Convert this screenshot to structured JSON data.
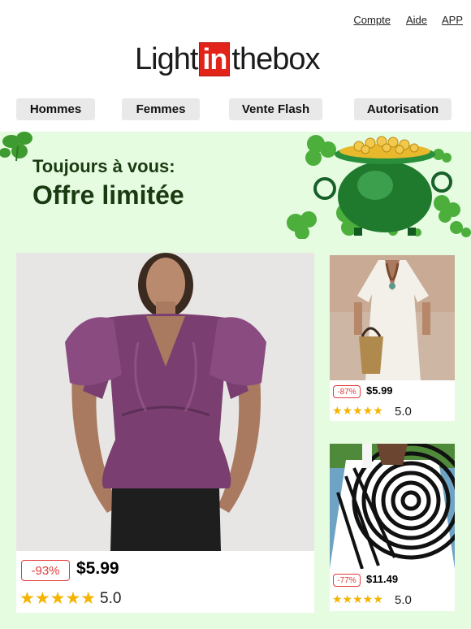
{
  "header": {
    "links": {
      "account": "Compte",
      "help": "Aide",
      "app": "APP"
    },
    "logo": {
      "part1": "Light",
      "part2": "in",
      "part3": "thebox"
    }
  },
  "nav": {
    "men": "Hommes",
    "women": "Femmes",
    "flash": "Vente Flash",
    "auth": "Autorisation"
  },
  "hero": {
    "subtitle": "Toujours à vous:",
    "title": "Offre limitée",
    "background": "#e6fce0"
  },
  "products": [
    {
      "discount": "-93%",
      "price": "$5.99",
      "stars": "★★★★★",
      "rating": "5.0",
      "image": "purple-satin-blouse"
    },
    {
      "discount": "-87%",
      "price": "$5.99",
      "stars": "★★★★★",
      "rating": "5.0",
      "image": "white-linen-dress"
    },
    {
      "discount": "-77%",
      "price": "$11.49",
      "stars": "★★★★★",
      "rating": "5.0",
      "image": "optical-illusion-shirt"
    }
  ],
  "colors": {
    "discount": "#e23b3b",
    "star": "#f4b400",
    "logo_box": "#e2231a",
    "hero_text": "#1a3b12"
  }
}
